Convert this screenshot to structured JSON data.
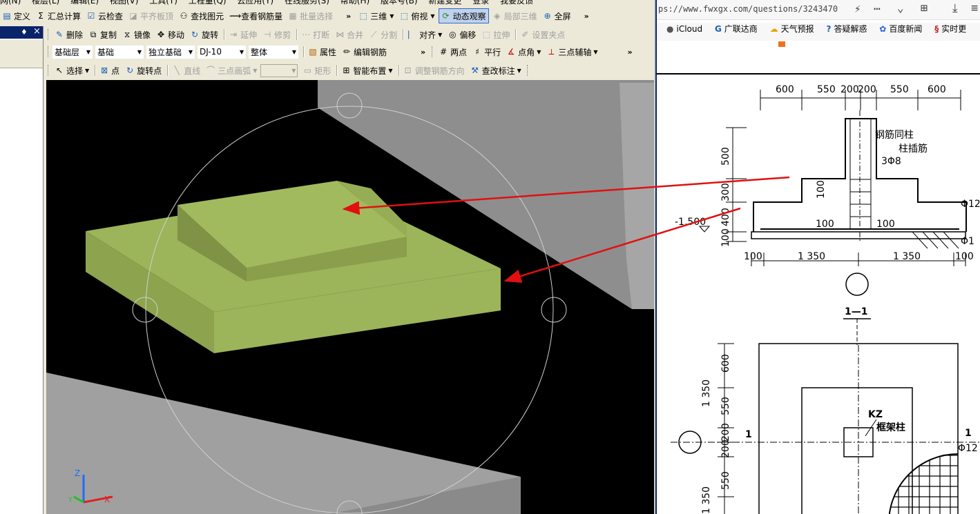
{
  "left_app": {
    "menu_bar_partial": [
      "网(N)",
      "楼层(L)",
      "编辑(E)",
      "视图(V)",
      "工具(T)",
      "工程量(Q)",
      "云应用(Y)",
      "在线服务(S)",
      "帮助(H)",
      "版本号(B)"
    ],
    "menu_new_change": "新建变更",
    "menu_login": "登录",
    "menu_feedback": "我要反馈",
    "toolbar1": {
      "define": "定义",
      "summary": "汇总计算",
      "cloud_check": "云检查",
      "level_slab": "平齐板顶",
      "find_element": "查找图元",
      "view_rebar": "查看钢筋量",
      "batch_select": "批量选择",
      "three_d": "三维",
      "top_view": "俯视",
      "dynamic_view": "动态观察",
      "local_3d": "局部三维",
      "fullscreen": "全屏",
      "more": "»"
    },
    "toolbar2": {
      "delete": "删除",
      "copy": "复制",
      "mirror": "镜像",
      "move": "移动",
      "rotate": "旋转",
      "extend": "延伸",
      "trim": "修剪",
      "break": "打断",
      "merge": "合并",
      "split": "分割",
      "align": "对齐",
      "offset": "偏移",
      "stretch": "拉伸",
      "set_grip": "设置夹点"
    },
    "toolbar3": {
      "layer": "基础层",
      "category": "基础",
      "type": "独立基础",
      "element": "DJ-10",
      "whole": "整体",
      "properties": "属性",
      "edit_rebar": "编辑钢筋",
      "more": "»",
      "two_points": "两点",
      "parallel": "平行",
      "point_angle": "点角",
      "three_point_axis": "三点辅轴",
      "more2": "»"
    },
    "toolbar4": {
      "select": "选择",
      "point": "点",
      "rotate_point": "旋转点",
      "line": "直线",
      "three_point_arc": "三点画弧",
      "rectangle": "矩形",
      "smart_layout": "智能布置",
      "adjust_rebar_dir": "调整钢筋方向",
      "modify_label": "查改标注"
    },
    "panel_pin": "♦",
    "panel_close": "×",
    "axis_labels": {
      "z": "Z",
      "x": "X",
      "y": "Y"
    }
  },
  "browser": {
    "url": "ps://www.fwxgx.com/questions/3243470",
    "bookmarks": [
      {
        "icon": "apple-icon",
        "label": "iCloud"
      },
      {
        "icon": "g-logo-icon",
        "label": "广联达商"
      },
      {
        "icon": "weather-icon",
        "label": "天气预报"
      },
      {
        "icon": "qa-icon",
        "label": "答疑解惑"
      },
      {
        "icon": "baidu-icon",
        "label": "百度新闻"
      },
      {
        "icon": "realtime-icon",
        "label": "实时更"
      }
    ],
    "drawing": {
      "top_dims": [
        "600",
        "550",
        "200",
        "200",
        "550",
        "600"
      ],
      "labels": {
        "rebar_same_column": "钢筋同柱",
        "column_dowel": "柱插筋",
        "stirrup": "3Φ8",
        "elev": "-1.500",
        "rebar_right1": "Φ12",
        "rebar_right2": "Φ1",
        "inner_100_left": "100",
        "inner_100_right": "100",
        "dim_100_small": "100",
        "section_label": "1—1",
        "kz": "KZ",
        "frame_column": "框架柱",
        "section_mark_left": "1",
        "section_mark_right": "1",
        "rebar_plan": "Φ12"
      },
      "left_dims": [
        "500",
        "300",
        "400",
        "100"
      ],
      "bottom_dims": [
        "100",
        "1 350",
        "1 350",
        "100"
      ],
      "plan_left_dims": [
        "1 350",
        "600",
        "550",
        "200",
        "200",
        "550",
        "1 350"
      ]
    }
  }
}
